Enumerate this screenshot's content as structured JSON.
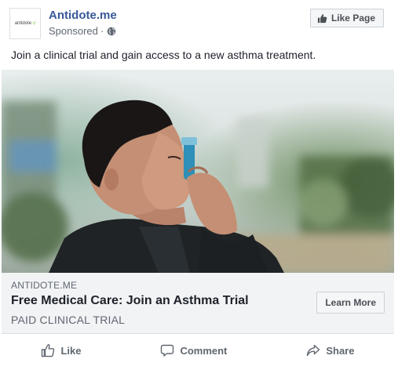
{
  "post": {
    "page_name": "Antidote.me",
    "sponsored": "Sponsored",
    "separator": "·",
    "logo_text": "antidote",
    "logo_mark": "⁴∕",
    "like_page_label": "Like Page",
    "message": "Join a clinical trial and gain access to a new asthma treatment."
  },
  "link_preview": {
    "domain": "ANTIDOTE.ME",
    "title": "Free Medical Care: Join an Asthma Trial",
    "description": "PAID CLINICAL TRIAL",
    "cta_label": "Learn More"
  },
  "actions": {
    "like_label": "Like",
    "comment_label": "Comment",
    "share_label": "Share"
  },
  "icons": {
    "privacy": "globe-icon",
    "like_page": "thumbs-up-icon",
    "like": "thumbs-up-outline-icon",
    "comment": "speech-bubble-icon",
    "share": "share-arrow-icon"
  },
  "colors": {
    "page_name": "#385898",
    "secondary_text": "#606770",
    "link_box_bg": "#f2f3f5",
    "button_bg": "#f5f6f7",
    "logo_accent": "#7bd148"
  }
}
